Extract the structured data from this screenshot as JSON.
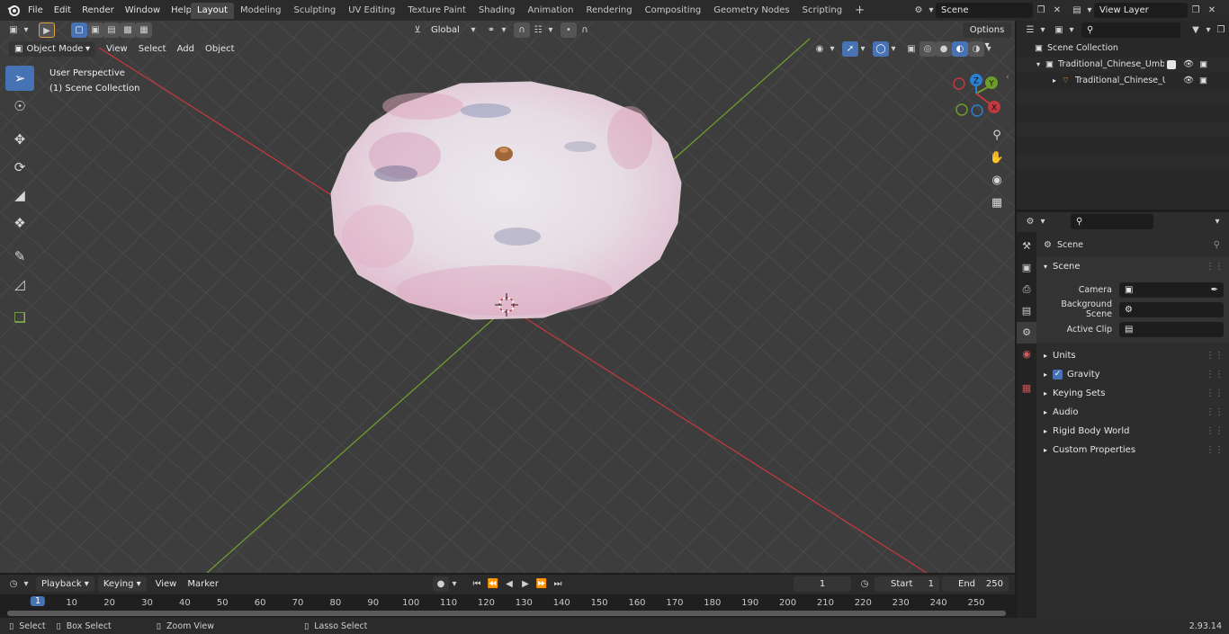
{
  "menu": {
    "file": "File",
    "edit": "Edit",
    "render": "Render",
    "window": "Window",
    "help": "Help"
  },
  "workspaces": [
    "Layout",
    "Modeling",
    "Sculpting",
    "UV Editing",
    "Texture Paint",
    "Shading",
    "Animation",
    "Rendering",
    "Compositing",
    "Geometry Nodes",
    "Scripting"
  ],
  "active_workspace": "Layout",
  "scene_field": "Scene",
  "view_layer_field": "View Layer",
  "viewport": {
    "mode": "Object Mode",
    "menus": {
      "view": "View",
      "select": "Select",
      "add": "Add",
      "object": "Object"
    },
    "transform_orientation": "Global",
    "options": "Options",
    "perspective_label": "User Perspective",
    "collection_label": "(1) Scene Collection",
    "gizmo": {
      "x": "X",
      "y": "Y",
      "z": "Z"
    }
  },
  "outliner": {
    "root": "Scene Collection",
    "collection": "Traditional_Chinese_Umbrella",
    "object": "Traditional_Chinese_Umt"
  },
  "properties": {
    "context": "Scene",
    "panel": "Scene",
    "camera_label": "Camera",
    "background_label": "Background Scene",
    "clip_label": "Active Clip",
    "sections": [
      "Units",
      "Gravity",
      "Keying Sets",
      "Audio",
      "Rigid Body World",
      "Custom Properties"
    ],
    "gravity_checked": true
  },
  "timeline": {
    "menus": {
      "playback": "Playback",
      "keying": "Keying",
      "view": "View",
      "marker": "Marker"
    },
    "current_frame": "1",
    "start_label": "Start",
    "start_value": "1",
    "end_label": "End",
    "end_value": "250",
    "ruler": [
      "1",
      "10",
      "20",
      "30",
      "40",
      "50",
      "60",
      "70",
      "80",
      "90",
      "100",
      "110",
      "120",
      "130",
      "140",
      "150",
      "160",
      "170",
      "180",
      "190",
      "200",
      "210",
      "220",
      "230",
      "240",
      "250"
    ]
  },
  "statusbar": {
    "select": "Select",
    "box_select": "Box Select",
    "zoom_view": "Zoom View",
    "lasso_select": "Lasso Select",
    "version": "2.93.14"
  },
  "colors": {
    "accent": "#4772b3",
    "x_axis": "#c0393f",
    "y_axis": "#6e9c2b",
    "z_axis": "#2a7fd1"
  }
}
